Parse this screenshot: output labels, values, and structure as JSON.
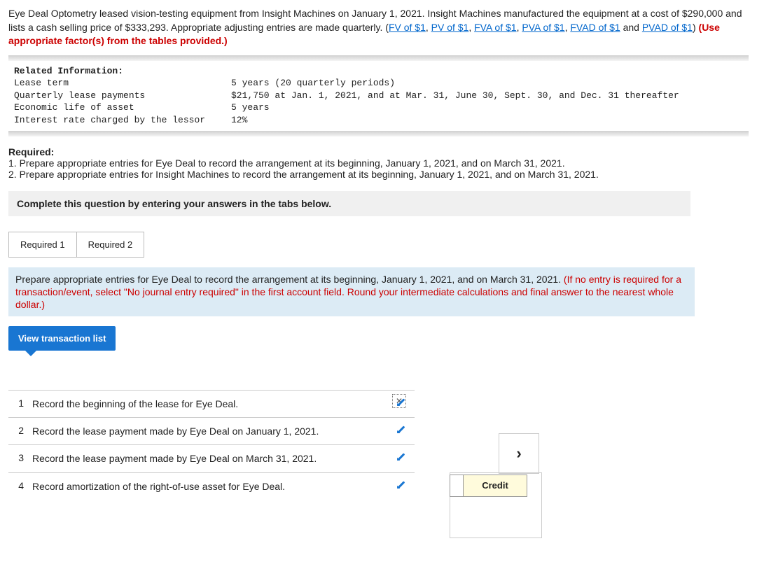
{
  "problem": {
    "intro_a": "Eye Deal Optometry leased vision-testing equipment from Insight Machines on January 1, 2021. Insight Machines manufactured the equipment at a cost of $290,000 and lists a cash selling price of $333,293. Appropriate adjusting entries are made quarterly. (",
    "link1": "FV of $1",
    "sep": ", ",
    "link2": "PV of $1",
    "link3": "FVA of $1",
    "link4": "PVA of $1",
    "link5": "FVAD of $1",
    "and": " and ",
    "link6": "PVAD of $1",
    "close": ") ",
    "redtext": "(Use appropriate factor(s) from the tables provided.)"
  },
  "info": {
    "heading": "Related Information:",
    "rows": [
      {
        "label": "Lease term",
        "value": "5 years (20 quarterly periods)"
      },
      {
        "label": "Quarterly lease payments",
        "value": "$21,750 at Jan. 1, 2021, and at Mar. 31, June 30, Sept. 30, and Dec. 31 thereafter"
      },
      {
        "label": "Economic life of asset",
        "value": "5 years"
      },
      {
        "label": "Interest rate charged by the lessor",
        "value": "12%"
      }
    ]
  },
  "required": {
    "title": "Required:",
    "r1": "1. Prepare appropriate entries for Eye Deal to record the arrangement at its beginning, January 1, 2021, and on March 31, 2021.",
    "r2": "2. Prepare appropriate entries for Insight Machines to record the arrangement at its beginning, January 1, 2021, and on March 31, 2021."
  },
  "instruction": "Complete this question by entering your answers in the tabs below.",
  "tabs": {
    "t1": "Required 1",
    "t2": "Required 2"
  },
  "prompt": {
    "black": "Prepare appropriate entries for Eye Deal to record the arrangement at its beginning, January 1, 2021, and on March 31, 2021. ",
    "red": "(If no entry is required for a transaction/event, select \"No journal entry required\" in the first account field. Round your intermediate calculations and final answer to the nearest whole dollar.)"
  },
  "view_btn": "View transaction list",
  "transactions": [
    {
      "n": "1",
      "desc": "Record the beginning of the lease for Eye Deal."
    },
    {
      "n": "2",
      "desc": "Record the lease payment made by Eye Deal on January 1, 2021."
    },
    {
      "n": "3",
      "desc": "Record the lease payment made by Eye Deal on March 31, 2021."
    },
    {
      "n": "4",
      "desc": "Record amortization of the right-of-use asset for Eye Deal."
    }
  ],
  "credit": "Credit",
  "next": "›"
}
